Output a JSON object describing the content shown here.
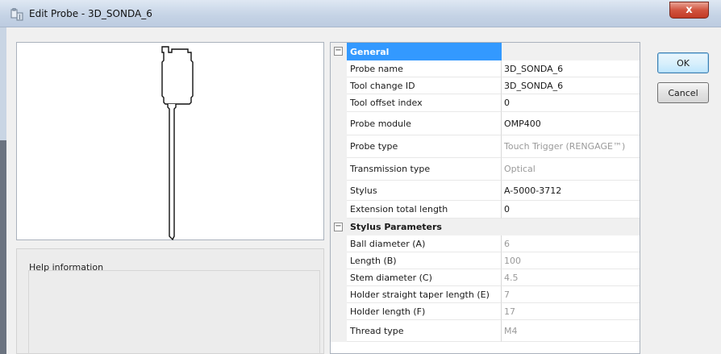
{
  "window": {
    "title": "Edit Probe - 3D_SONDA_6",
    "close_glyph": "x"
  },
  "help": {
    "label": "Help information"
  },
  "buttons": {
    "ok": "OK",
    "cancel": "Cancel"
  },
  "property_grid": {
    "categories": [
      {
        "name": "General",
        "toggle": "−",
        "rows": [
          {
            "name": "Probe name",
            "value": "3D_SONDA_6",
            "readonly": false
          },
          {
            "name": "Tool change ID",
            "value": "3D_SONDA_6",
            "readonly": false
          },
          {
            "name": "Tool offset index",
            "value": "0",
            "readonly": false
          },
          {
            "name": "Probe module",
            "value": "OMP400",
            "readonly": false
          },
          {
            "name": "Probe type",
            "value": "Touch Trigger (RENGAGE™)",
            "readonly": true
          },
          {
            "name": "Transmission type",
            "value": "Optical",
            "readonly": true
          },
          {
            "name": "Stylus",
            "value": "A-5000-3712",
            "readonly": false
          },
          {
            "name": "Extension total length",
            "value": "0",
            "readonly": false
          }
        ]
      },
      {
        "name": "Stylus Parameters",
        "toggle": "−",
        "rows": [
          {
            "name": "Ball diameter (A)",
            "value": "6",
            "readonly": true
          },
          {
            "name": "Length (B)",
            "value": "100",
            "readonly": true
          },
          {
            "name": "Stem diameter (C)",
            "value": "4.5",
            "readonly": true
          },
          {
            "name": "Holder straight taper length (E)",
            "value": "7",
            "readonly": true
          },
          {
            "name": "Holder length (F)",
            "value": "17",
            "readonly": true
          },
          {
            "name": "Thread type",
            "value": "M4",
            "readonly": true
          }
        ]
      }
    ]
  },
  "colors": {
    "selection": "#3399ff",
    "readonly_text": "#9a9a9a"
  }
}
